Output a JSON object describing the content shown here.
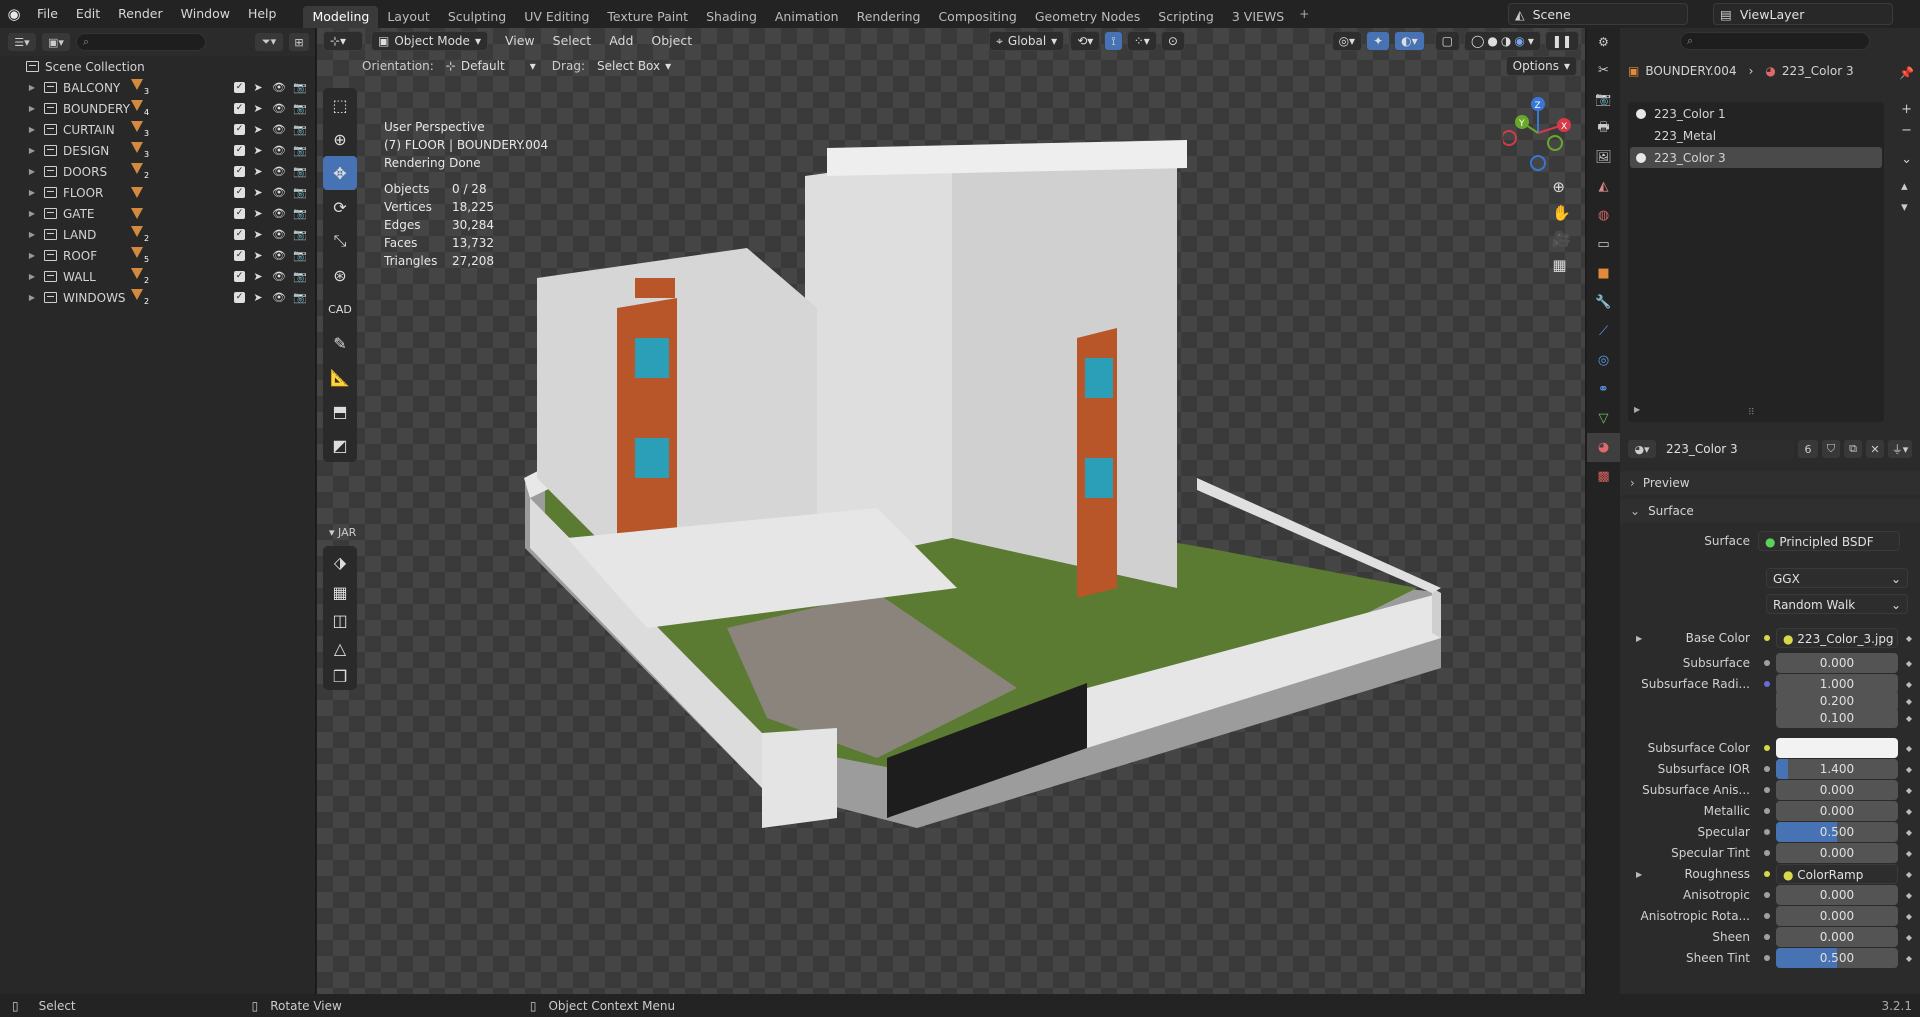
{
  "menu": [
    "File",
    "Edit",
    "Render",
    "Window",
    "Help"
  ],
  "workspaces": [
    "Modeling",
    "Layout",
    "Sculpting",
    "UV Editing",
    "Texture Paint",
    "Shading",
    "Animation",
    "Rendering",
    "Compositing",
    "Geometry Nodes",
    "Scripting",
    "3 VIEWS"
  ],
  "scene_name": "Scene",
  "view_layer": "ViewLayer",
  "outliner": {
    "root": "Scene Collection",
    "items": [
      {
        "name": "BALCONY",
        "count": "3"
      },
      {
        "name": "BOUNDERY",
        "count": "4"
      },
      {
        "name": "CURTAIN",
        "count": "3"
      },
      {
        "name": "DESIGN",
        "count": "3"
      },
      {
        "name": "DOORS",
        "count": "2"
      },
      {
        "name": "FLOOR",
        "count": ""
      },
      {
        "name": "GATE",
        "count": ""
      },
      {
        "name": "LAND",
        "count": "2"
      },
      {
        "name": "ROOF",
        "count": "5"
      },
      {
        "name": "WALL",
        "count": "2"
      },
      {
        "name": "WINDOWS",
        "count": "2"
      }
    ]
  },
  "viewport": {
    "mode": "Object Mode",
    "menus": [
      "View",
      "Select",
      "Add",
      "Object"
    ],
    "transform": "Global",
    "orientation_label": "Orientation:",
    "orientation": "Default",
    "drag_label": "Drag:",
    "drag": "Select Box",
    "options": "Options",
    "perspective": "User Perspective",
    "active": "(7) FLOOR | BOUNDERY.004",
    "render_status": "Rendering Done",
    "stats": [
      {
        "label": "Objects",
        "value": "0 / 28"
      },
      {
        "label": "Vertices",
        "value": "18,225"
      },
      {
        "label": "Edges",
        "value": "30,284"
      },
      {
        "label": "Faces",
        "value": "13,732"
      },
      {
        "label": "Triangles",
        "value": "27,208"
      }
    ],
    "cad_label": "CAD",
    "jar_label": "JAR"
  },
  "properties": {
    "object": "BOUNDERY.004",
    "material": "223_Color 3",
    "slots": [
      "223_Color 1",
      "223_Metal",
      "223_Color 3"
    ],
    "material_name": "223_Color 3",
    "user_count": "6",
    "preview_label": "Preview",
    "surface_label": "Surface",
    "surface_shader": "Principled BSDF",
    "distribution": "GGX",
    "subsurface_method": "Random Walk",
    "rows": [
      {
        "label": "Base Color",
        "value": "223_Color_3.jpg",
        "kind": "link",
        "expand": true
      },
      {
        "label": "Subsurface",
        "value": "0.000",
        "kind": "num",
        "fill": 0
      },
      {
        "label": "Subsurface Radi...",
        "value": "1.000",
        "kind": "num",
        "fill": 0
      },
      {
        "label": "",
        "value": "0.200",
        "kind": "num",
        "fill": 0
      },
      {
        "label": "",
        "value": "0.100",
        "kind": "num",
        "fill": 0
      },
      {
        "label": "Subsurface Color",
        "value": "",
        "kind": "color"
      },
      {
        "label": "Subsurface IOR",
        "value": "1.400",
        "kind": "num",
        "fill": 0.1
      },
      {
        "label": "Subsurface Anis...",
        "value": "0.000",
        "kind": "num",
        "fill": 0
      },
      {
        "label": "Metallic",
        "value": "0.000",
        "kind": "num",
        "fill": 0
      },
      {
        "label": "Specular",
        "value": "0.500",
        "kind": "num",
        "fill": 0.5
      },
      {
        "label": "Specular Tint",
        "value": "0.000",
        "kind": "num",
        "fill": 0
      },
      {
        "label": "Roughness",
        "value": "ColorRamp",
        "kind": "link",
        "expand": true
      },
      {
        "label": "Anisotropic",
        "value": "0.000",
        "kind": "num",
        "fill": 0
      },
      {
        "label": "Anisotropic Rota...",
        "value": "0.000",
        "kind": "num",
        "fill": 0
      },
      {
        "label": "Sheen",
        "value": "0.000",
        "kind": "num",
        "fill": 0
      },
      {
        "label": "Sheen Tint",
        "value": "0.500",
        "kind": "num",
        "fill": 0.5
      }
    ]
  },
  "status": {
    "select": "Select",
    "rotate": "Rotate View",
    "context": "Object Context Menu",
    "version": "3.2.1"
  },
  "colors": {
    "accent": "#4772b3",
    "collection_badge": "#d38a3e"
  }
}
